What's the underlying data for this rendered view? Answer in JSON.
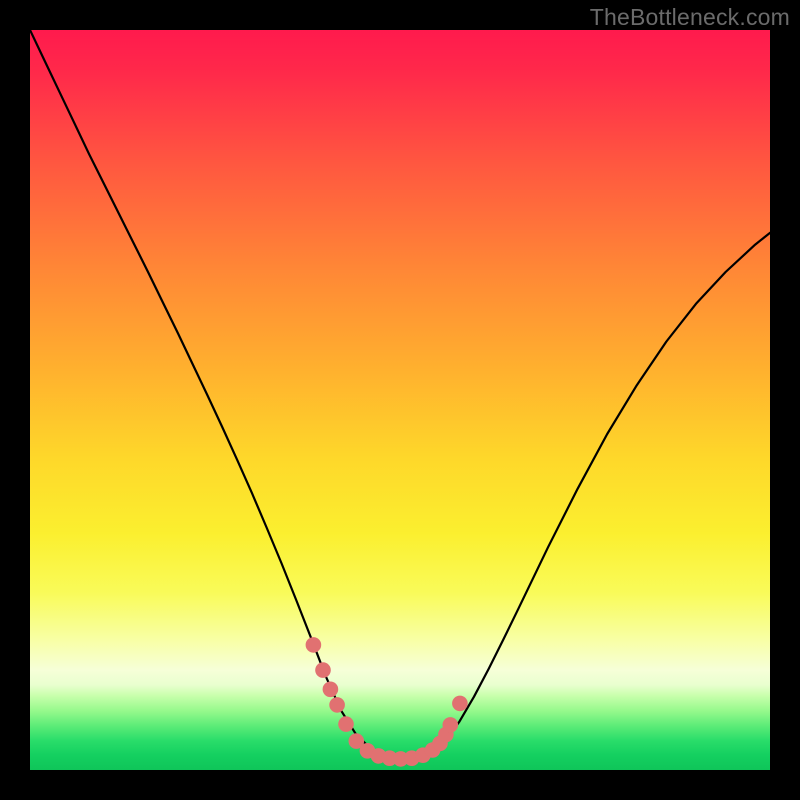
{
  "watermark": {
    "text": "TheBottleneck.com"
  },
  "colors": {
    "curve_stroke": "#000000",
    "marker_fill": "#e17171",
    "marker_stroke": "#cf5a5a",
    "gradient_top": "#ff1a4d",
    "gradient_bottom": "#0fc559",
    "frame": "#000000"
  },
  "chart_data": {
    "type": "line",
    "title": "",
    "xlabel": "",
    "ylabel": "",
    "xlim": [
      0,
      100
    ],
    "ylim": [
      0,
      100
    ],
    "grid": false,
    "legend": "none",
    "note": "Axes are unlabeled in the source image; values are normalized 0–100 along each axis, with y=0 at the bottom (green) and y=100 at the top (red). Approximated from pixel positions.",
    "series": [
      {
        "name": "bottleneck-curve",
        "x": [
          0,
          2,
          4,
          6,
          8,
          10,
          12,
          14,
          16,
          18,
          20,
          22,
          24,
          26,
          28,
          30,
          32,
          34,
          36,
          38,
          40,
          42,
          44,
          46,
          48,
          50,
          52,
          54,
          56,
          58,
          60,
          62,
          64,
          66,
          70,
          74,
          78,
          82,
          86,
          90,
          94,
          98,
          100
        ],
        "y": [
          100,
          95.8,
          91.6,
          87.4,
          83.2,
          79.2,
          75.2,
          71.2,
          67.2,
          63.1,
          59.0,
          54.8,
          50.6,
          46.3,
          41.9,
          37.4,
          32.7,
          27.9,
          22.9,
          17.8,
          12.6,
          8.1,
          4.9,
          2.9,
          1.8,
          1.5,
          1.6,
          2.3,
          3.9,
          6.5,
          9.9,
          13.7,
          17.7,
          21.8,
          30.1,
          38.0,
          45.4,
          52.0,
          57.9,
          63.0,
          67.3,
          71.0,
          72.6
        ]
      }
    ],
    "markers": {
      "name": "highlight-dots",
      "x": [
        38.3,
        39.6,
        40.6,
        41.5,
        42.7,
        44.1,
        45.6,
        47.1,
        48.6,
        50.1,
        51.6,
        53.1,
        54.4,
        55.4,
        56.2,
        56.8,
        58.1
      ],
      "y": [
        16.9,
        13.5,
        10.9,
        8.8,
        6.2,
        3.9,
        2.6,
        1.9,
        1.6,
        1.5,
        1.6,
        2.0,
        2.7,
        3.6,
        4.8,
        6.1,
        9.0
      ]
    }
  }
}
